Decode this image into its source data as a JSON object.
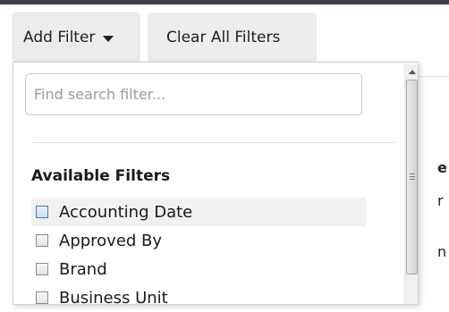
{
  "toolbar": {
    "add_filter_label": "Add Filter",
    "clear_all_label": "Clear All Filters"
  },
  "dropdown": {
    "search": {
      "placeholder": "Find search filter...",
      "value": ""
    },
    "heading": "Available Filters",
    "items": [
      {
        "label": "Accounting Date",
        "checked": false,
        "highlighted": true
      },
      {
        "label": "Approved By",
        "checked": false,
        "highlighted": false
      },
      {
        "label": "Brand",
        "checked": false,
        "highlighted": false
      },
      {
        "label": "Business Unit",
        "checked": false,
        "highlighted": false
      }
    ]
  },
  "background": {
    "snippet_1": "e",
    "snippet_2": "r",
    "snippet_3": "n"
  },
  "colors": {
    "top_border": "#3a3f4a",
    "button_bg": "#ececec",
    "highlight_row": "#f1f1f1",
    "checkbox_focus": "#3c7fb1"
  },
  "icons": {
    "dropdown_caret": "caret-down-icon",
    "scroll_up": "arrow-up-icon",
    "scroll_grip": "grip-icon"
  }
}
